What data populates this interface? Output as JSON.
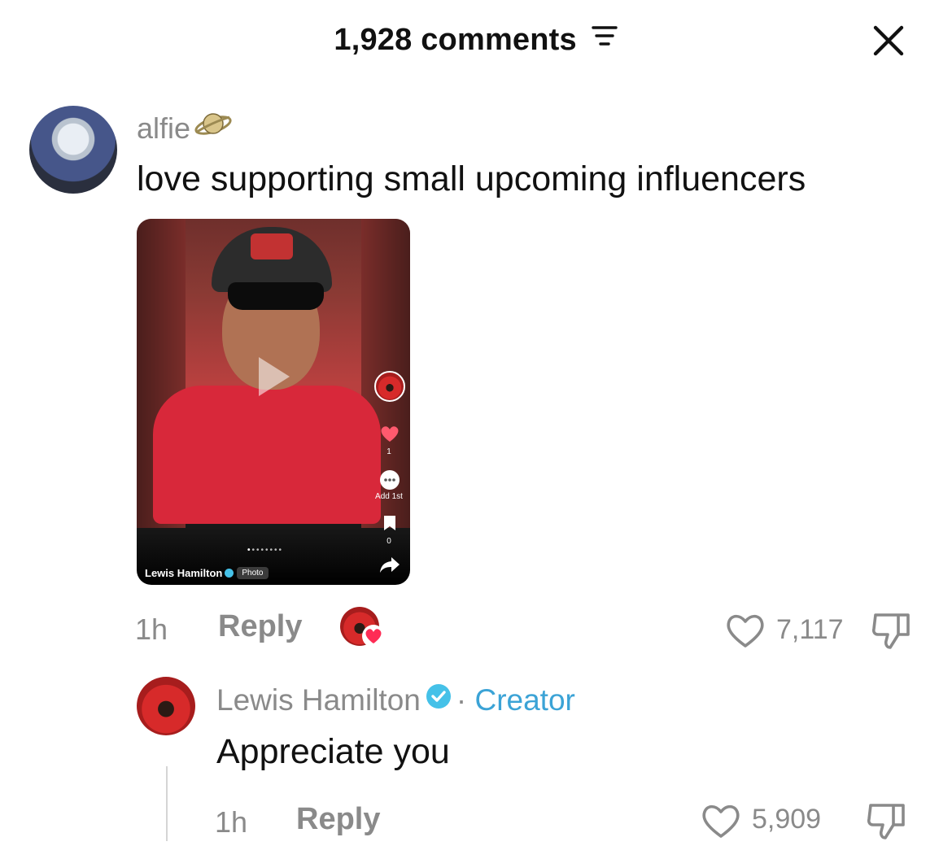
{
  "header": {
    "title": "1,928 comments",
    "filter_icon": "filter-lines-icon",
    "close_icon": "close-icon"
  },
  "comment": {
    "username": "alfie",
    "username_emoji": "ringed-planet",
    "text": "love supporting small upcoming influencers",
    "media": {
      "author": "Lewis Hamilton",
      "type_tag": "Photo",
      "side_like_count": "1",
      "side_comment_label": "Add 1st",
      "side_save_count": "0"
    },
    "time": "1h",
    "reply_label": "Reply",
    "like_count": "7,117",
    "creator_liked": true
  },
  "reply": {
    "author": "Lewis Hamilton",
    "separator": "·",
    "badge": "Creator",
    "text": "Appreciate you",
    "time": "1h",
    "reply_label": "Reply",
    "like_count": "5,909"
  },
  "colors": {
    "muted_text": "#8a8a8a",
    "creator_blue": "#3ba3d6",
    "verified_blue": "#45c1e8",
    "heart_red": "#fe2c55"
  }
}
